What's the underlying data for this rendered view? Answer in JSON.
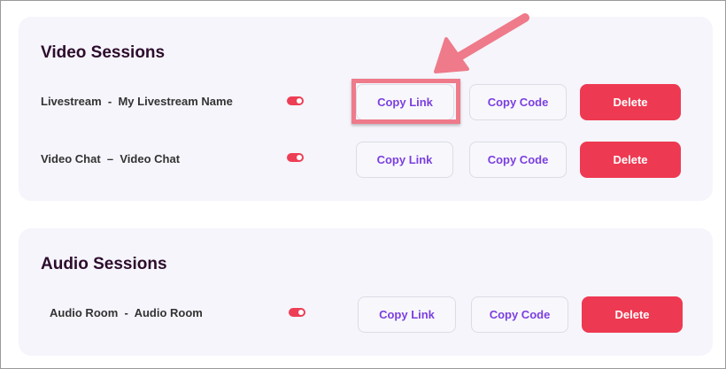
{
  "video_sessions": {
    "title": "Video Sessions",
    "rows": [
      {
        "name": "Livestream",
        "separator": "-",
        "session_name": "My Livestream Name",
        "copy_link_label": "Copy Link",
        "copy_code_label": "Copy Code",
        "delete_label": "Delete"
      },
      {
        "name": "Video Chat",
        "separator": "–",
        "session_name": "Video Chat",
        "copy_link_label": "Copy Link",
        "copy_code_label": "Copy Code",
        "delete_label": "Delete"
      }
    ]
  },
  "audio_sessions": {
    "title": "Audio Sessions",
    "rows": [
      {
        "name": "Audio Room",
        "separator": "-",
        "session_name": "Audio Room",
        "copy_link_label": "Copy Link",
        "copy_code_label": "Copy Code",
        "delete_label": "Delete"
      }
    ]
  },
  "colors": {
    "accent": "#7b3fe0",
    "delete": "#ee3952",
    "toggle": "#ee3e55",
    "annotation": "#ee7a8a",
    "title": "#2d0c2c",
    "card_bg": "#f5f5fb"
  },
  "icons": {
    "toggle": "toggle-on-icon",
    "annotation": "arrow-annotation-icon"
  }
}
